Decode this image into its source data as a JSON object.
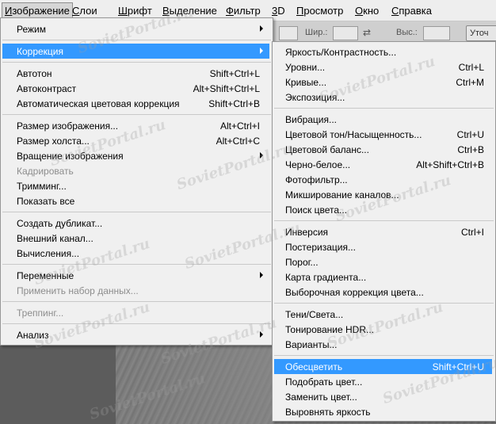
{
  "menubar": [
    {
      "label": "Изображение",
      "active": true
    },
    {
      "label": "Слои"
    },
    {
      "label": "Шрифт"
    },
    {
      "label": "Выделение"
    },
    {
      "label": "Фильтр"
    },
    {
      "label": "3D"
    },
    {
      "label": "Просмотр"
    },
    {
      "label": "Окно"
    },
    {
      "label": "Справка"
    }
  ],
  "options": {
    "width_label": "Шир.:",
    "height_label": "Выс.:",
    "button_label": "Уточ"
  },
  "watermark": "SovietPortal.ru",
  "image_menu": [
    {
      "label": "Режим",
      "submenu": true
    },
    {
      "sep": true
    },
    {
      "label": "Коррекция",
      "submenu": true,
      "highlighted": true
    },
    {
      "sep": true
    },
    {
      "label": "Автотон",
      "shortcut": "Shift+Ctrl+L"
    },
    {
      "label": "Автоконтраст",
      "shortcut": "Alt+Shift+Ctrl+L"
    },
    {
      "label": "Автоматическая цветовая коррекция",
      "shortcut": "Shift+Ctrl+B"
    },
    {
      "sep": true
    },
    {
      "label": "Размер изображения...",
      "shortcut": "Alt+Ctrl+I"
    },
    {
      "label": "Размер холста...",
      "shortcut": "Alt+Ctrl+C"
    },
    {
      "label": "Вращение изображения",
      "submenu": true
    },
    {
      "label": "Кадрировать",
      "disabled": true
    },
    {
      "label": "Тримминг..."
    },
    {
      "label": "Показать все"
    },
    {
      "sep": true
    },
    {
      "label": "Создать дубликат..."
    },
    {
      "label": "Внешний канал..."
    },
    {
      "label": "Вычисления..."
    },
    {
      "sep": true
    },
    {
      "label": "Переменные",
      "submenu": true
    },
    {
      "label": "Применить набор данных...",
      "disabled": true
    },
    {
      "sep": true
    },
    {
      "label": "Треппинг...",
      "disabled": true
    },
    {
      "sep": true
    },
    {
      "label": "Анализ",
      "submenu": true
    }
  ],
  "correction_menu": [
    {
      "label": "Яркость/Контрастность..."
    },
    {
      "label": "Уровни...",
      "shortcut": "Ctrl+L"
    },
    {
      "label": "Кривые...",
      "shortcut": "Ctrl+M"
    },
    {
      "label": "Экспозиция..."
    },
    {
      "sep": true
    },
    {
      "label": "Вибрация..."
    },
    {
      "label": "Цветовой тон/Насыщенность...",
      "shortcut": "Ctrl+U"
    },
    {
      "label": "Цветовой баланс...",
      "shortcut": "Ctrl+B"
    },
    {
      "label": "Черно-белое...",
      "shortcut": "Alt+Shift+Ctrl+B"
    },
    {
      "label": "Фотофильтр..."
    },
    {
      "label": "Микширование каналов..."
    },
    {
      "label": "Поиск цвета..."
    },
    {
      "sep": true
    },
    {
      "label": "Инверсия",
      "shortcut": "Ctrl+I"
    },
    {
      "label": "Постеризация..."
    },
    {
      "label": "Порог..."
    },
    {
      "label": "Карта градиента..."
    },
    {
      "label": "Выборочная коррекция цвета..."
    },
    {
      "sep": true
    },
    {
      "label": "Тени/Света..."
    },
    {
      "label": "Тонирование HDR..."
    },
    {
      "label": "Варианты..."
    },
    {
      "sep": true
    },
    {
      "label": "Обесцветить",
      "shortcut": "Shift+Ctrl+U",
      "highlighted": true
    },
    {
      "label": "Подобрать цвет..."
    },
    {
      "label": "Заменить цвет..."
    },
    {
      "label": "Выровнять яркость"
    }
  ]
}
